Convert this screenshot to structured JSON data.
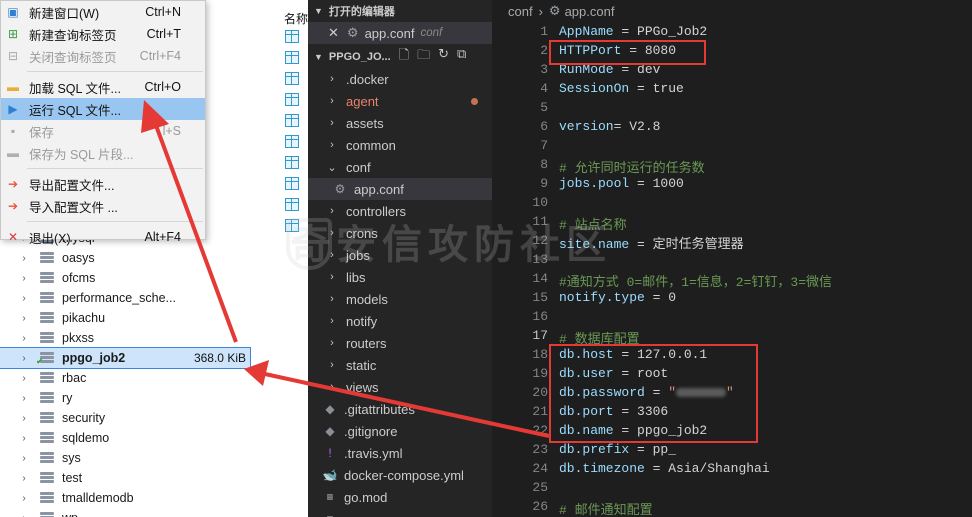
{
  "sql_client": {
    "context_menu": [
      {
        "label": "新建窗口(W)",
        "shortcut": "Ctrl+N",
        "icon": "new-window-icon",
        "disabled": false
      },
      {
        "label": "新建查询标签页",
        "shortcut": "Ctrl+T",
        "icon": "new-query-icon",
        "disabled": false
      },
      {
        "label": "关闭查询标签页",
        "shortcut": "Ctrl+F4",
        "icon": "close-query-icon",
        "disabled": true
      },
      {
        "label": "加载 SQL 文件...",
        "shortcut": "Ctrl+O",
        "icon": "folder-icon",
        "disabled": false
      },
      {
        "label": "运行 SQL 文件...",
        "shortcut": "",
        "icon": "run-icon",
        "disabled": false,
        "highlighted": true
      },
      {
        "label": "保存",
        "shortcut": "l+S",
        "icon": "save-icon",
        "disabled": true
      },
      {
        "label": "保存为 SQL 片段...",
        "shortcut": "",
        "icon": "save-snippet-icon",
        "disabled": true
      },
      {
        "label": "导出配置文件...",
        "shortcut": "",
        "icon": "export-icon",
        "disabled": false
      },
      {
        "label": "导入配置文件 ...",
        "shortcut": "",
        "icon": "import-icon",
        "disabled": false
      },
      {
        "label": "退出(X)",
        "shortcut": "Alt+F4",
        "icon": "close-icon",
        "disabled": false
      }
    ],
    "column_header": "名称",
    "databases": [
      {
        "name": "mysql"
      },
      {
        "name": "oasys"
      },
      {
        "name": "ofcms"
      },
      {
        "name": "performance_sche..."
      },
      {
        "name": "pikachu"
      },
      {
        "name": "pkxss"
      },
      {
        "name": "ppgo_job2",
        "size": "368.0 KiB",
        "selected": true
      },
      {
        "name": "rbac"
      },
      {
        "name": "ry"
      },
      {
        "name": "security"
      },
      {
        "name": "sqldemo"
      },
      {
        "name": "sys"
      },
      {
        "name": "test"
      },
      {
        "name": "tmalldemodb"
      },
      {
        "name": "wp"
      }
    ]
  },
  "vscode": {
    "open_editors_title": "打开的编辑器",
    "open_file": {
      "name": "app.conf",
      "path": "conf"
    },
    "project_title": "PPGO_JO...",
    "files": [
      {
        "name": ".docker",
        "type": "folder",
        "open": false
      },
      {
        "name": "agent",
        "type": "folder",
        "open": false,
        "modified": true
      },
      {
        "name": "assets",
        "type": "folder",
        "open": false
      },
      {
        "name": "common",
        "type": "folder",
        "open": false
      },
      {
        "name": "conf",
        "type": "folder",
        "open": true
      },
      {
        "name": "app.conf",
        "type": "file",
        "icon": "gear-icon",
        "active": true
      },
      {
        "name": "controllers",
        "type": "folder",
        "open": false
      },
      {
        "name": "crons",
        "type": "folder",
        "open": false
      },
      {
        "name": "jobs",
        "type": "folder",
        "open": false
      },
      {
        "name": "libs",
        "type": "folder",
        "open": false
      },
      {
        "name": "models",
        "type": "folder",
        "open": false
      },
      {
        "name": "notify",
        "type": "folder",
        "open": false
      },
      {
        "name": "routers",
        "type": "folder",
        "open": false
      },
      {
        "name": "static",
        "type": "folder",
        "open": false
      },
      {
        "name": "views",
        "type": "folder",
        "open": false
      },
      {
        "name": ".gitattributes",
        "type": "file",
        "icon": "git-icon"
      },
      {
        "name": ".gitignore",
        "type": "file",
        "icon": "git-icon"
      },
      {
        "name": ".travis.yml",
        "type": "file",
        "icon": "yaml-icon"
      },
      {
        "name": "docker-compose.yml",
        "type": "file",
        "icon": "docker-icon"
      },
      {
        "name": "go.mod",
        "type": "file",
        "icon": "go-icon"
      },
      {
        "name": "go.sum",
        "type": "file",
        "icon": "go-icon"
      }
    ],
    "breadcrumb": [
      "conf",
      "app.conf"
    ],
    "code_lines": [
      {
        "n": "1",
        "k": "AppName",
        "op": " = ",
        "v": "PPGo_Job2"
      },
      {
        "n": "2",
        "k": "HTTPPort",
        "op": " = ",
        "v": "8080"
      },
      {
        "n": "3",
        "k": "RunMode",
        "op": " = ",
        "v": "dev"
      },
      {
        "n": "4",
        "k": "SessionOn",
        "op": " = ",
        "v": "true"
      },
      {
        "n": "5",
        "text": ""
      },
      {
        "n": "6",
        "k": "version",
        "op": "= ",
        "v": "V2.8"
      },
      {
        "n": "7",
        "text": ""
      },
      {
        "n": "8",
        "comment": "# 允许同时运行的任务数"
      },
      {
        "n": "9",
        "k": "jobs.pool",
        "op": " = ",
        "v": "1000"
      },
      {
        "n": "10",
        "text": ""
      },
      {
        "n": "11",
        "comment": "# 站点名称"
      },
      {
        "n": "12",
        "k": "site.name",
        "op": " = ",
        "v": "定时任务管理器"
      },
      {
        "n": "13",
        "text": ""
      },
      {
        "n": "14",
        "comment": "#通知方式 0=邮件，1=信息，2=钉钉，3=微信"
      },
      {
        "n": "15",
        "k": "notify.type",
        "op": " = ",
        "v": "0"
      },
      {
        "n": "16",
        "text": ""
      },
      {
        "n": "17",
        "comment": "# 数据库配置",
        "current": true
      },
      {
        "n": "18",
        "k": "db.host",
        "op": " = ",
        "v": "127.0.0.1"
      },
      {
        "n": "19",
        "k": "db.user",
        "op": " = ",
        "v": "root"
      },
      {
        "n": "20",
        "k": "db.password",
        "op": " = ",
        "v": "\"",
        "redacted": true,
        "v2": "\""
      },
      {
        "n": "21",
        "k": "db.port",
        "op": " = ",
        "v": "3306"
      },
      {
        "n": "22",
        "k": "db.name",
        "op": " = ",
        "v": "ppgo_job2"
      },
      {
        "n": "23",
        "k": "db.prefix",
        "op": " = ",
        "v": "pp_"
      },
      {
        "n": "24",
        "k": "db.timezone",
        "op": " = ",
        "v": "Asia/Shanghai"
      },
      {
        "n": "25",
        "text": ""
      },
      {
        "n": "26",
        "comment": "# 邮件通知配置"
      }
    ]
  },
  "watermark": "奇安信攻防社区",
  "colors": {
    "annotation_red": "#e53935",
    "menu_highlight": "#99c6f0",
    "editor_bg": "#1e1e1e"
  }
}
